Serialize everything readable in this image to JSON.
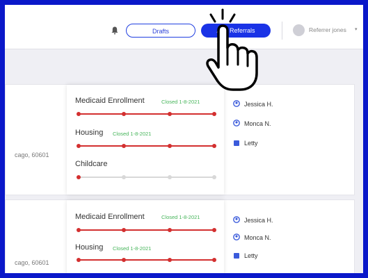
{
  "header": {
    "drafts_label": "Drafts",
    "add_referrals_label": "Add Referrals",
    "user_name": "Referrer jones",
    "user_caret": "▾"
  },
  "colors": {
    "frame": "#0a18c9",
    "primary": "#1a33e6",
    "closed_green": "#46b55a",
    "track_red": "#d32f2f",
    "track_grey": "#d8d8d8"
  },
  "icons": [
    "bell-icon",
    "avatar-icon",
    "chevron-down-icon",
    "person-icon",
    "square-icon",
    "pointing-hand-icon"
  ],
  "cards": [
    {
      "address": "cago, 60601",
      "services": [
        {
          "name": "Medicaid Enrollment",
          "status": "Closed 1-8-2021",
          "progress": "complete"
        },
        {
          "name": "Housing",
          "status": "Closed 1-8-2021",
          "progress": "complete"
        },
        {
          "name": "Childcare",
          "status": "",
          "progress": "started"
        }
      ],
      "people": [
        "Jessica H.",
        "Monca N.",
        "Letty"
      ]
    },
    {
      "address": "cago, 60601",
      "services": [
        {
          "name": "Medicaid Enrollment",
          "status": "Closed 1-8-2021",
          "progress": "complete"
        },
        {
          "name": "Housing",
          "status": "Closed 1-8-2021",
          "progress": "complete"
        }
      ],
      "people": [
        "Jessica H.",
        "Monca N.",
        "Letty"
      ]
    }
  ]
}
